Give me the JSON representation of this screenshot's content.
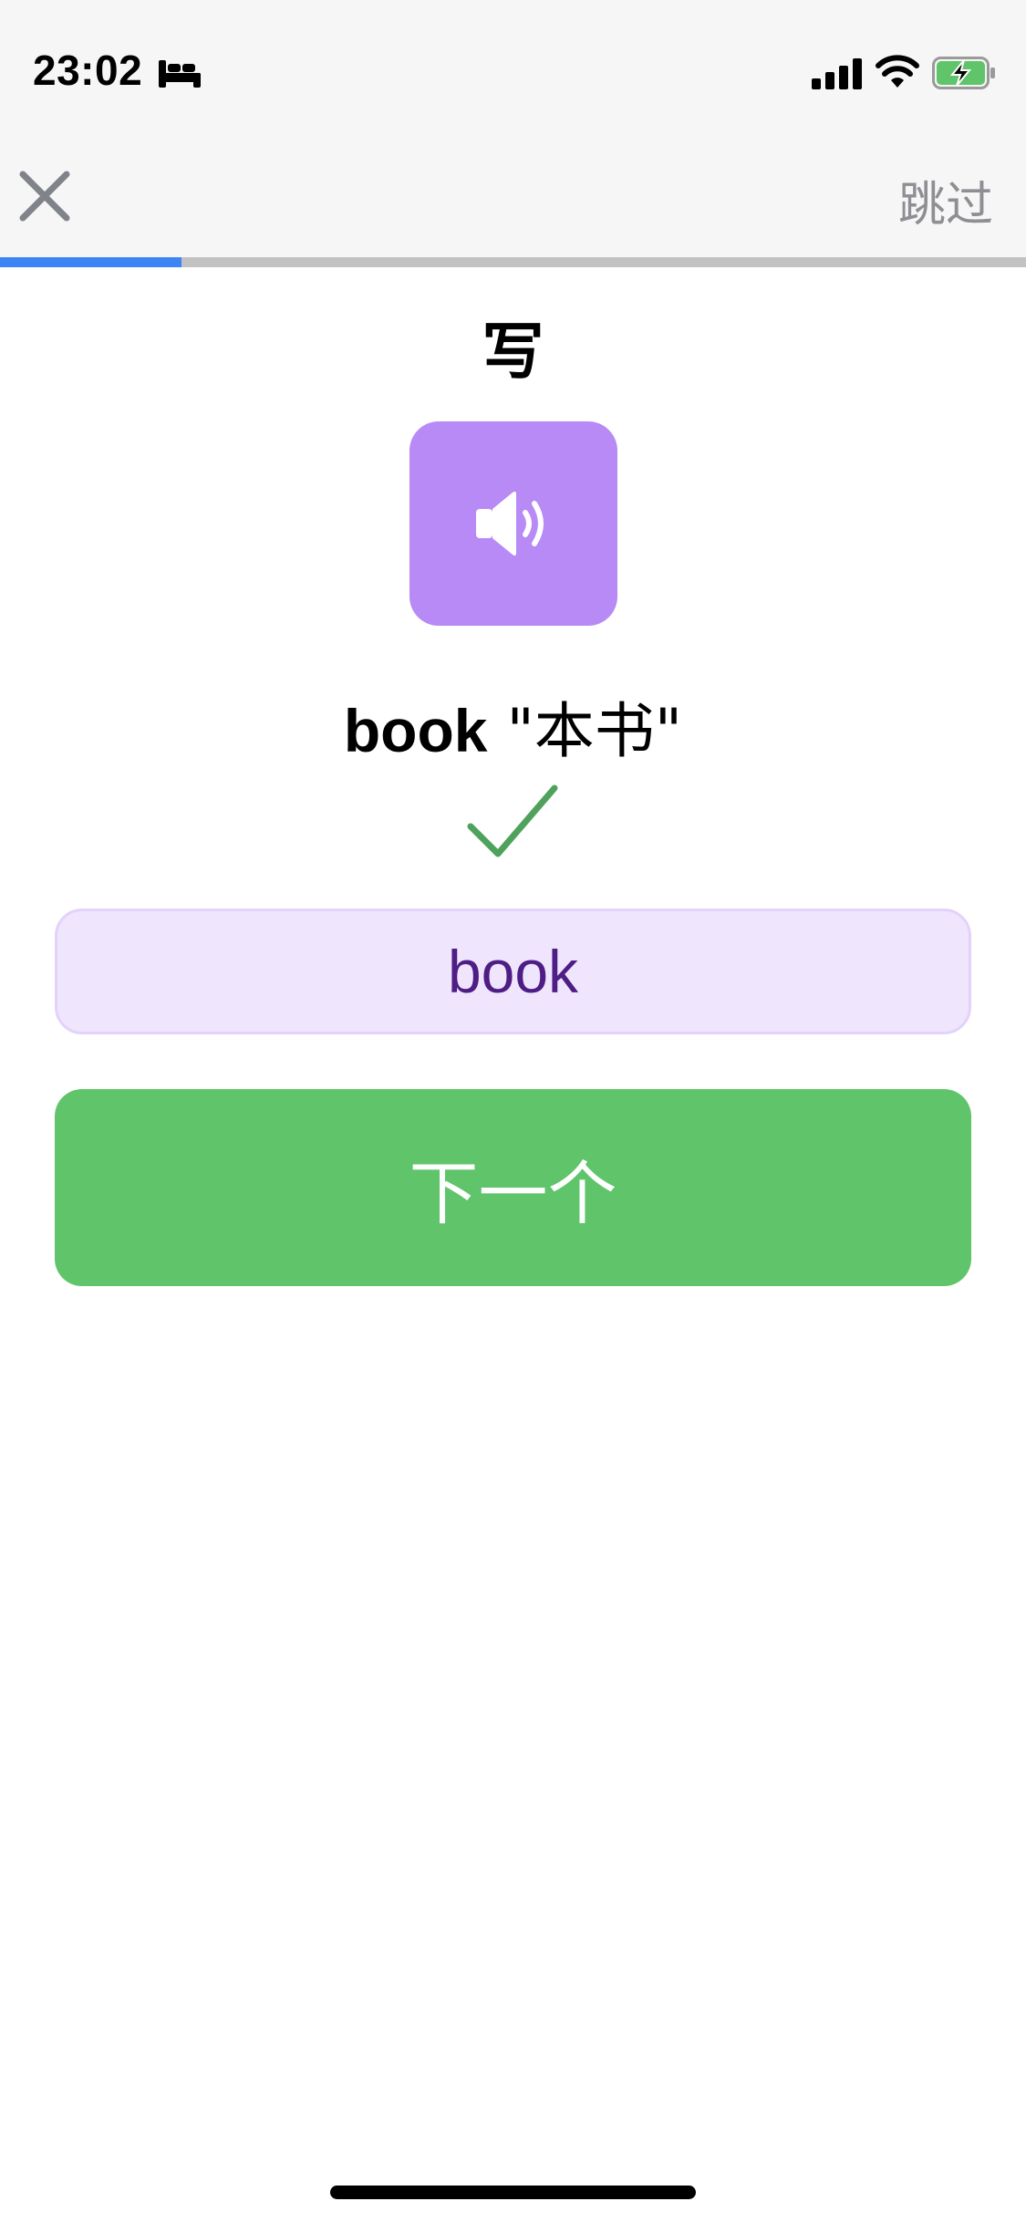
{
  "status_bar": {
    "time": "23:02",
    "sleep_icon": "bed-icon",
    "signal_icon": "cellular-signal-icon",
    "wifi_icon": "wifi-icon",
    "battery_icon": "battery-charging-icon"
  },
  "header": {
    "close_icon": "close-icon",
    "skip_label": "跳过"
  },
  "progress": {
    "fraction": 0.177,
    "fill_color": "#3d84f5",
    "track_color": "#c2c2c2"
  },
  "exercise": {
    "mode_title": "写",
    "audio_icon": "speaker-icon",
    "word": "book",
    "translation": "\"本书\"",
    "result_icon": "checkmark-icon",
    "answer": "book"
  },
  "actions": {
    "next_label": "下一个"
  },
  "colors": {
    "audio_button": "#b88af5",
    "answer_field_bg": "#efe5fc",
    "answer_text": "#4e1d85",
    "next_button": "#5fc46a",
    "check": "#4fa25c"
  }
}
